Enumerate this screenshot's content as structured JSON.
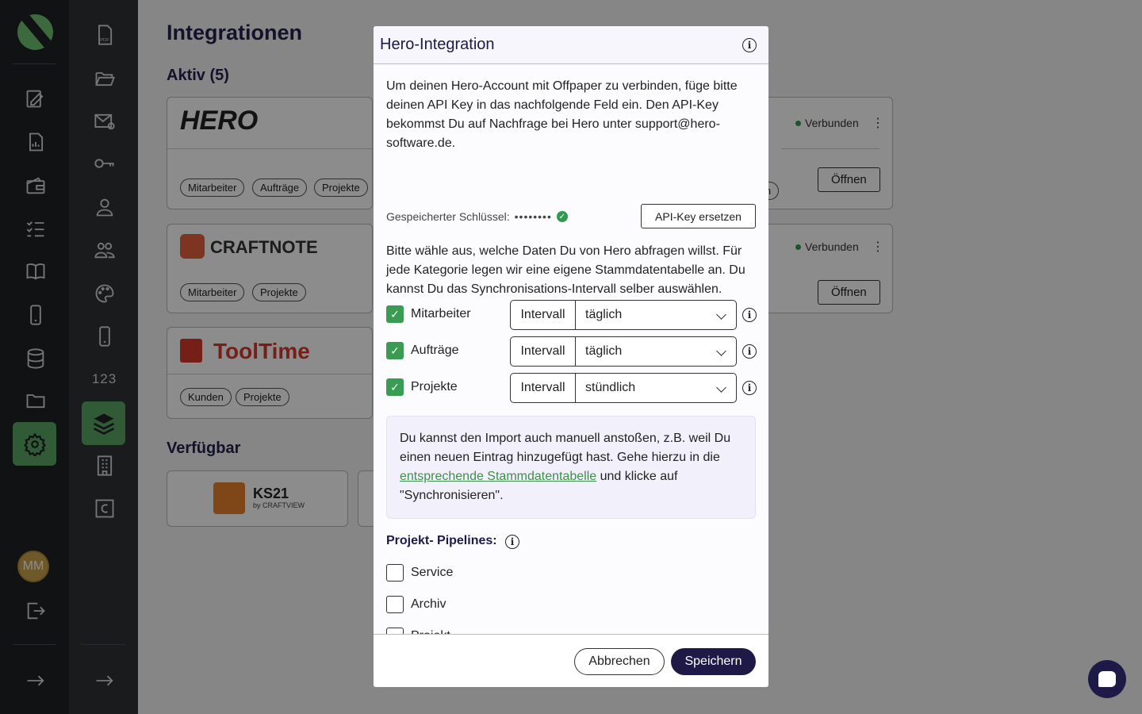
{
  "sidebar": {
    "avatar_initials": "MM",
    "counter_label": "123"
  },
  "main": {
    "title": "Integrationen",
    "active_heading": "Aktiv (5)",
    "available_heading": "Verfügbar",
    "cards": [
      {
        "brand": "HERO",
        "chips": [
          "Mitarbeiter",
          "Aufträge",
          "Projekte"
        ]
      },
      {
        "brand": "CRAFTNOTE",
        "chips": [
          "Mitarbeiter",
          "Projekte"
        ]
      },
      {
        "brand": "ToolTime",
        "chips": [
          "Kunden",
          "Projekte"
        ]
      }
    ],
    "right_cards": [
      {
        "status": "Verbunden",
        "open_label": "Öffnen",
        "partial_chip": "ten"
      },
      {
        "status": "Verbunden",
        "open_label": "Öffnen"
      }
    ],
    "available": [
      {
        "brand": "KS21",
        "sub": "by CRAFTVIEW"
      }
    ]
  },
  "modal": {
    "title": "Hero-Integration",
    "intro": "Um deinen Hero-Account mit Offpaper zu verbinden, füge bitte deinen API Key in das nachfolgende Feld ein. Den API-Key bekommst Du auf Nachfrage bei Hero unter support@hero-software.de.",
    "saved_key_label": "Gespeicherter Schlüssel:",
    "saved_key_mask": "••••••••",
    "replace_key_label": "API-Key ersetzen",
    "select_intro": "Bitte wähle aus, welche Daten Du von Hero abfragen willst. Für jede Kategorie legen wir eine eigene Stammdatentabelle an. Du kannst Du das Synchronisations-Intervall selber auswählen.",
    "categories": [
      {
        "label": "Mitarbeiter",
        "prefix": "Intervall",
        "interval": "täglich",
        "checked": true
      },
      {
        "label": "Aufträge",
        "prefix": "Intervall",
        "interval": "täglich",
        "checked": true
      },
      {
        "label": "Projekte",
        "prefix": "Intervall",
        "interval": "stündlich",
        "checked": true
      }
    ],
    "note_before": "Du kannst den Import auch manuell anstoßen, z.B. weil Du einen neuen Eintrag hinzugefügt hast. Gehe hierzu in die ",
    "note_link": "entsprechende Stammdatentabelle",
    "note_after": " und klicke auf \"Synchronisieren\".",
    "pipelines_title": "Projekt- Pipelines:",
    "pipelines": [
      {
        "label": "Service",
        "checked": false
      },
      {
        "label": "Archiv",
        "checked": false
      },
      {
        "label": "Projekt",
        "checked": false
      }
    ],
    "cancel_label": "Abbrechen",
    "save_label": "Speichern"
  },
  "colors": {
    "accent": "#1e1a47",
    "success": "#3a9b52",
    "sidebar": "#1f2124"
  }
}
